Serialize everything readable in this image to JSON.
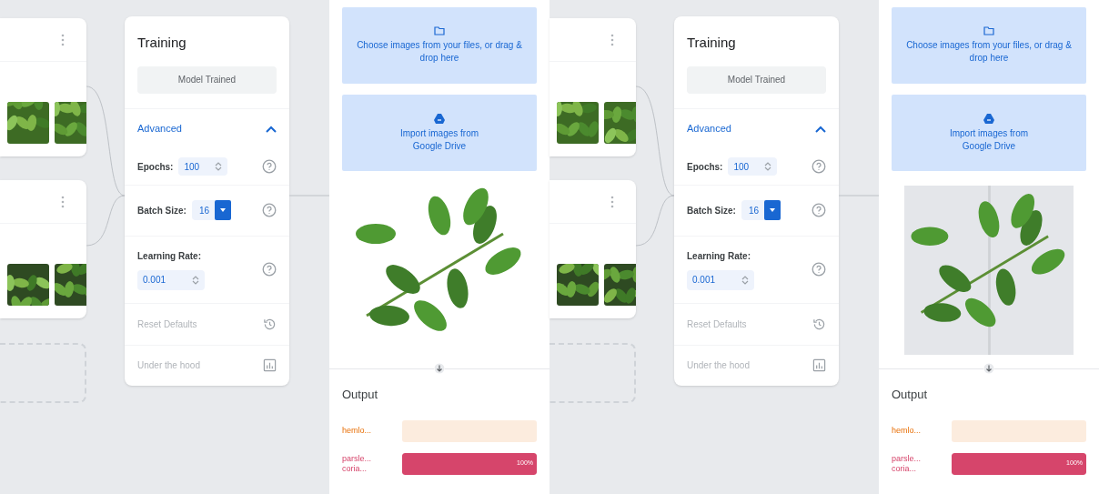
{
  "panels": [
    {
      "training": {
        "title": "Training",
        "button": "Model Trained",
        "advanced": {
          "label": "Advanced",
          "expanded": true
        },
        "epochs": {
          "label": "Epochs:",
          "value": "100"
        },
        "batch_size": {
          "label": "Batch Size:",
          "value": "16"
        },
        "learning_rate": {
          "label": "Learning Rate:",
          "value": "0.001"
        },
        "reset": "Reset Defaults",
        "under_the_hood": "Under the hood"
      },
      "preview": {
        "upload": "Choose images from your files, or drag & drop here",
        "drive": "Import images from Google Drive",
        "output": {
          "title": "Output",
          "rows": [
            {
              "label": [
                "hemlo..."
              ],
              "level": 0
            },
            {
              "label": [
                "parsle...",
                "coria..."
              ],
              "level": 1,
              "reading": "100%"
            }
          ]
        }
      }
    },
    {
      "training": {
        "title": "Training",
        "button": "Model Trained",
        "advanced": {
          "label": "Advanced",
          "expanded": true
        },
        "epochs": {
          "label": "Epochs:",
          "value": "100"
        },
        "batch_size": {
          "label": "Batch Size:",
          "value": "16"
        },
        "learning_rate": {
          "label": "Learning Rate:",
          "value": "0.001"
        },
        "reset": "Reset Defaults",
        "under_the_hood": "Under the hood"
      },
      "preview": {
        "upload": "Choose images from your files, or drag & drop here",
        "drive": "Import images from Google Drive",
        "output": {
          "title": "Output",
          "rows": [
            {
              "label": [
                "hemlo..."
              ],
              "level": 0
            },
            {
              "label": [
                "parsle...",
                "coria..."
              ],
              "level": 1,
              "reading": "100%"
            }
          ]
        }
      }
    }
  ]
}
